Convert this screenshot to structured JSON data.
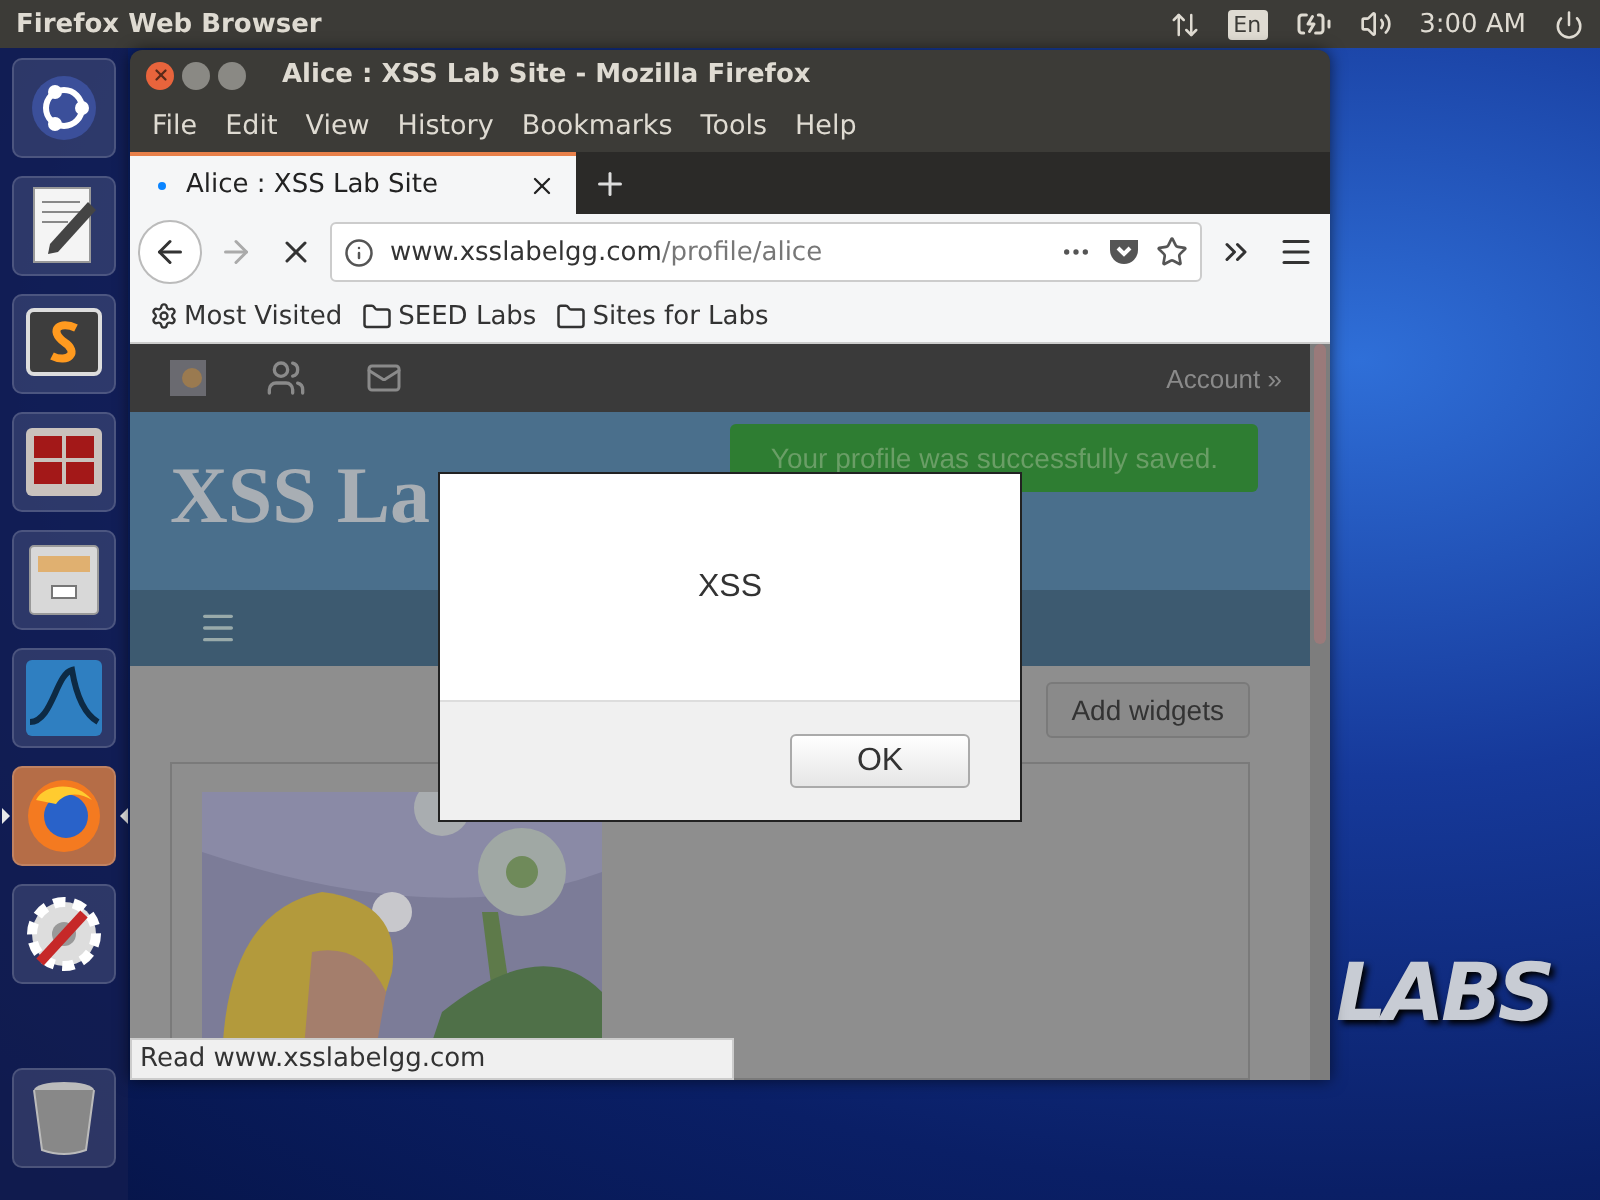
{
  "top_panel": {
    "app_name": "Firefox Web Browser",
    "keyboard": "En",
    "time": "3:00 AM"
  },
  "launcher": {
    "items": [
      {
        "kind": "home",
        "selected": false
      },
      {
        "kind": "notes",
        "selected": false
      },
      {
        "kind": "editor",
        "selected": false
      },
      {
        "kind": "terminal",
        "selected": false
      },
      {
        "kind": "files",
        "selected": false
      },
      {
        "kind": "capture",
        "selected": false
      },
      {
        "kind": "browser",
        "selected": true
      },
      {
        "kind": "settings",
        "selected": false
      }
    ],
    "trash": {
      "kind": "trash",
      "selected": false
    }
  },
  "desktop": {
    "logo_text": "LABS"
  },
  "window": {
    "title": "Alice : XSS Lab Site - Mozilla Firefox",
    "menu": [
      "File",
      "Edit",
      "View",
      "History",
      "Bookmarks",
      "Tools",
      "Help"
    ],
    "tabs": [
      {
        "label": "Alice : XSS Lab Site",
        "selected": true,
        "loading": true
      }
    ],
    "navigation": {
      "back_disabled": false,
      "forward_disabled": true,
      "url_host": "www.xsslabelgg.com",
      "url_path": "/profile/alice"
    },
    "bookmarks": [
      {
        "kind": "smart",
        "label": "Most Visited"
      },
      {
        "kind": "folder",
        "label": "SEED Labs"
      },
      {
        "kind": "folder",
        "label": "Sites for Labs"
      }
    ],
    "page": {
      "topbar": {
        "account": "Account »"
      },
      "site_title": "XSS La",
      "message": "Your profile was successfully saved.",
      "add_widgets": "Add widgets"
    },
    "status": "Read www.xsslabelgg.com"
  },
  "dialog": {
    "message": "XSS",
    "button": "OK"
  }
}
